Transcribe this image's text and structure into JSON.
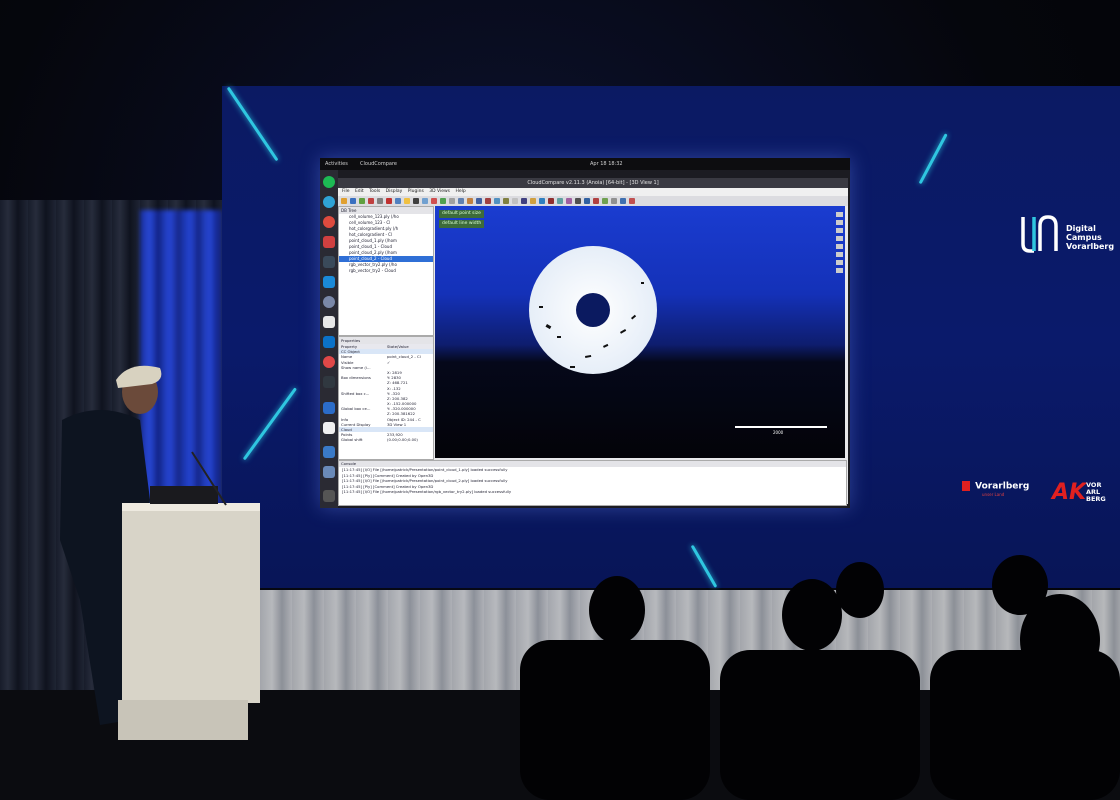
{
  "desktop": {
    "activities": "Activities",
    "app_name": "CloudCompare",
    "clock": "Apr 18 18:32"
  },
  "window": {
    "title": "CloudCompare v2.11.3 (Anoia) [64-bit] - [3D View 1]",
    "menu": [
      "File",
      "Edit",
      "Tools",
      "Display",
      "Plugins",
      "3D Views",
      "Help"
    ]
  },
  "db_tree": {
    "header": "DB Tree",
    "items": [
      {
        "label": "cell_volume_123.ply (/ho",
        "selected": false
      },
      {
        "label": "cell_volume_123 - Cl",
        "selected": false
      },
      {
        "label": "hot_colorgradient.ply (/h",
        "selected": false
      },
      {
        "label": "hot_colorgradient - Cl",
        "selected": false
      },
      {
        "label": "point_cloud_1.ply (/hom",
        "selected": false
      },
      {
        "label": "point_cloud_1 - Cloud",
        "selected": false
      },
      {
        "label": "point_cloud_2.ply (/hom",
        "selected": false
      },
      {
        "label": "point_cloud_2 - Cloud",
        "selected": true
      },
      {
        "label": "rgb_vector_try2.ply (/ho",
        "selected": false
      },
      {
        "label": "rgb_vector_try2 - Cloud",
        "selected": false
      }
    ]
  },
  "properties": {
    "header": "Properties",
    "columns": [
      "Property",
      "State/Value"
    ],
    "rows": [
      [
        "CC Object",
        ""
      ],
      [
        "Name",
        "point_cloud_2 - Cl"
      ],
      [
        "Visible",
        "✓"
      ],
      [
        "Show name (i...",
        ""
      ],
      [
        "",
        "X: 2819"
      ],
      [
        "Box dimensions",
        "Y: 2830"
      ],
      [
        "",
        "Z: 468.721"
      ],
      [
        "",
        "X: -132"
      ],
      [
        "Shifted box c...",
        "Y: -320"
      ],
      [
        "",
        "Z: 200.382"
      ],
      [
        "",
        "X: -152.000000"
      ],
      [
        "Global box ce...",
        "Y: -320.000000"
      ],
      [
        "",
        "Z: 200.381622"
      ],
      [
        "Info",
        "Object ID: 244 - C"
      ],
      [
        "Current Display",
        "3D View 1"
      ],
      [
        "Cloud",
        ""
      ],
      [
        "Points",
        "233,920"
      ],
      [
        "Global shift",
        "(0.00;0.00;0.00)"
      ]
    ]
  },
  "view3d": {
    "overlay_point_size": "default point size",
    "overlay_line_width": "default line width",
    "scale_label": "2000"
  },
  "console": {
    "header": "Console",
    "lines": [
      "[11:17:45] [I/O] File [/home/patrick/Presentation/point_cloud_1.ply] loaded successfully",
      "[11:17:45] [Ply] [Comment] Created by Open3D",
      "[11:17:45] [I/O] File [/home/patrick/Presentation/point_cloud_2.ply] loaded successfully",
      "[11:17:45] [Ply] [Comment] Created by Open3D",
      "[11:17:45] [I/O] File [/home/patrick/Presentation/rgb_vector_try2.ply] loaded successfully"
    ]
  },
  "logos": {
    "dcv_line1": "Digital",
    "dcv_line2": "Campus",
    "dcv_line3": "Vorarlberg",
    "vorarlberg": "Vorarlberg",
    "vorarlberg_sub": "unser Land",
    "ak_big": "AK",
    "ak_line1": "VOR",
    "ak_line2": "ARL",
    "ak_line3": "BERG"
  },
  "colors": {
    "led_wall": "#0a1a6b",
    "accent": "#2fc6e0",
    "ak_red": "#e02020"
  }
}
